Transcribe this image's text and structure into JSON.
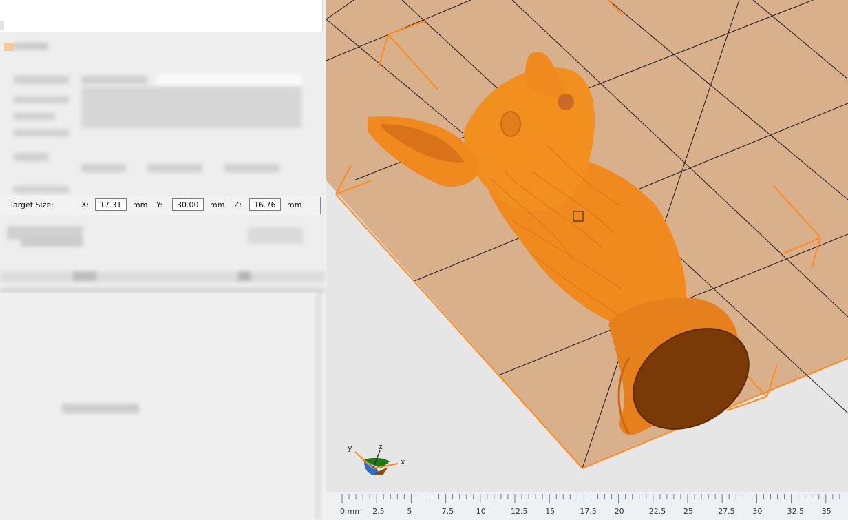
{
  "target_size": {
    "label": "Target Size:",
    "x_label": "X:",
    "x_value": "17.31",
    "y_label": "Y:",
    "y_value": "30.00",
    "z_label": "Z:",
    "z_value": "16.76",
    "unit": "mm"
  },
  "gizmo": {
    "x": "x",
    "y": "y",
    "z": "z"
  },
  "ruler": {
    "labels": [
      "0 mm",
      "2.5",
      "5",
      "7.5",
      "10",
      "12.5",
      "15",
      "17.5",
      "20",
      "22.5",
      "25",
      "27.5",
      "30",
      "32.5",
      "35"
    ]
  },
  "colors": {
    "model": "#f28a1e",
    "bed": "#d9b08c",
    "edge": "#ff8a1a"
  }
}
